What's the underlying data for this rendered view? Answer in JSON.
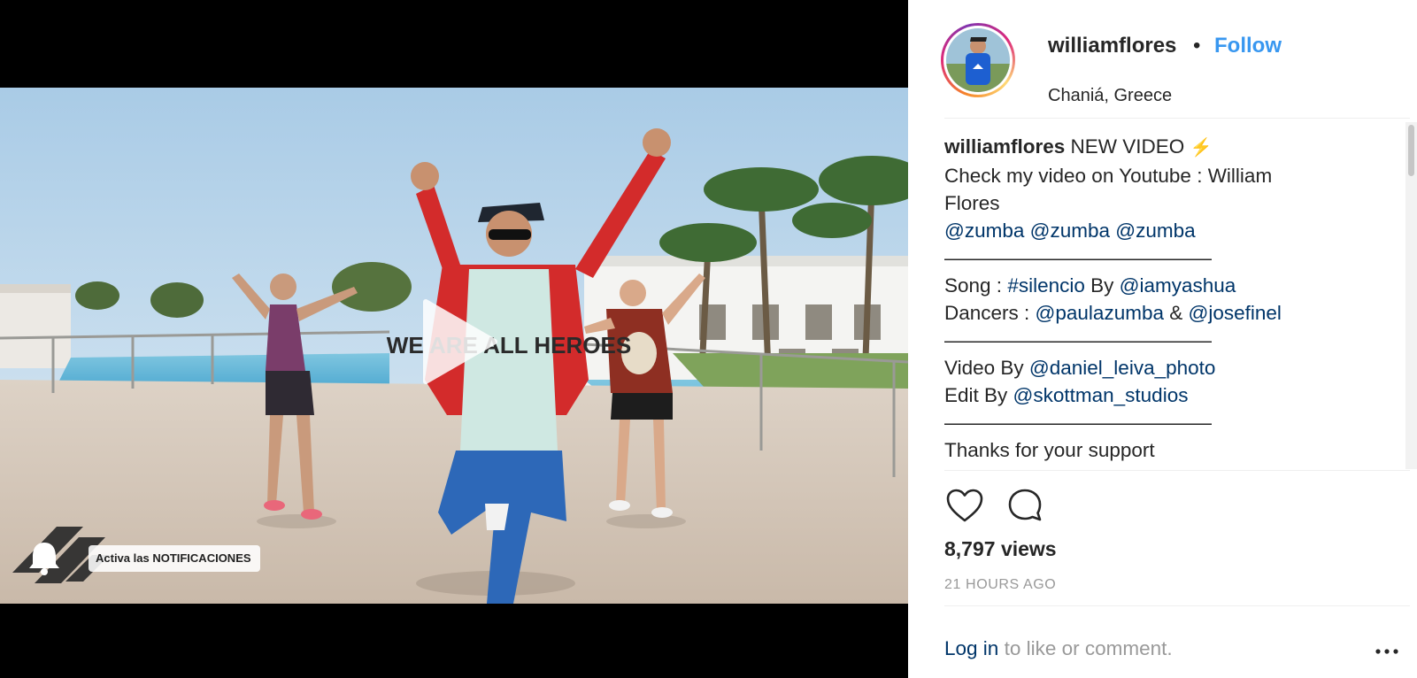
{
  "video": {
    "notification_overlay": "Activa las NOTIFICACIONES",
    "shirt_text": "WE ARE ALL HEROES"
  },
  "post": {
    "username": "williamflores",
    "separator": "•",
    "follow_label": "Follow",
    "location": "Chaniá, Greece",
    "caption": {
      "author": "williamflores",
      "headline": " NEW VIDEO",
      "headline_emoji": "⚡",
      "line2": "Check my video on Youtube : William",
      "line3": "Flores",
      "mentions_line": [
        "@zumba",
        "@zumba",
        "@zumba"
      ],
      "rule": "——————————————",
      "song_label": "Song : ",
      "song_tag": "#silencio",
      "song_by": " By ",
      "song_artist": "@iamyashua",
      "dancers_label": "Dancers : ",
      "dancer_1": "@paulazumba",
      "dancers_amp": " & ",
      "dancer_2": "@josefinel",
      "video_by_label": "Video By ",
      "video_by": "@daniel_leiva_photo",
      "edit_by_label": "Edit By ",
      "edit_by": "@skottman_studios",
      "thanks": "Thanks for your support"
    },
    "actions": {
      "like_icon": "heart-icon",
      "comment_icon": "speech-bubble-icon"
    },
    "views": "8,797 views",
    "timestamp": "21 HOURS AGO",
    "footer": {
      "login_link": "Log in",
      "login_suffix": " to like or comment.",
      "more_icon": "ellipsis-icon"
    }
  },
  "colors": {
    "link_blue": "#3897f0",
    "mention_navy": "#003569",
    "muted_gray": "#999999",
    "text_dark": "#262626"
  }
}
